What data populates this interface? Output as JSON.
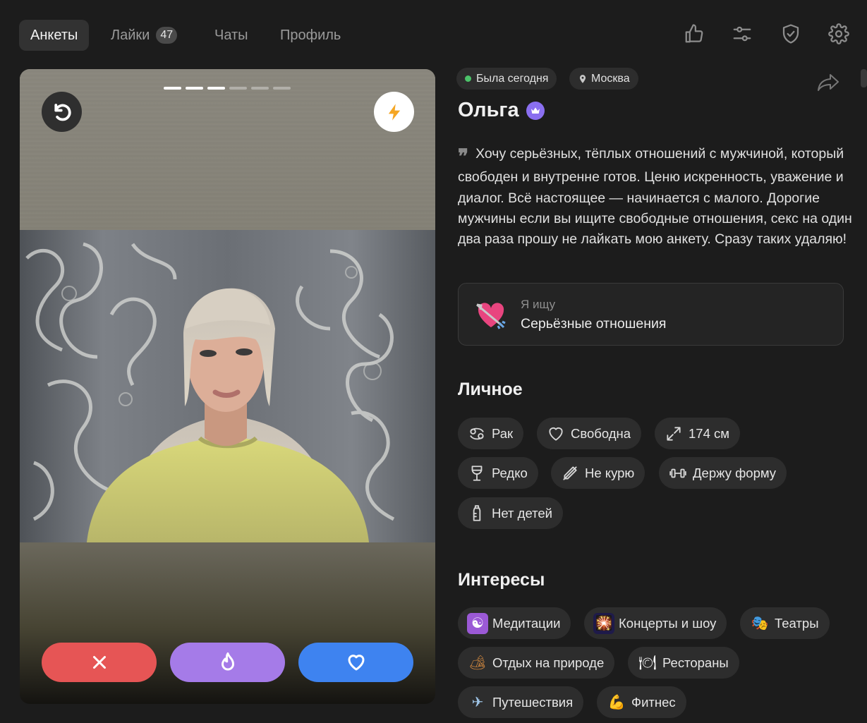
{
  "nav": {
    "tabs": [
      {
        "label": "Анкеты",
        "active": true
      },
      {
        "label": "Лайки",
        "count": "47"
      },
      {
        "label": "Чаты"
      },
      {
        "label": "Профиль"
      }
    ],
    "icons": [
      "thumbs-up-icon",
      "sliders-icon",
      "shield-check-icon",
      "gear-icon"
    ]
  },
  "card": {
    "photo_count": 6,
    "current_photo": 3,
    "buttons": {
      "undo": "undo-icon",
      "boost": "lightning-icon",
      "dislike": "close-icon",
      "superlike": "flame-icon",
      "like": "heart-icon"
    },
    "colors": {
      "dislike": "#e65555",
      "superlike": "#a57be8",
      "like": "#3e83f0"
    }
  },
  "profile": {
    "status": "Была сегодня",
    "city": "Москва",
    "name": "Ольга",
    "quote_mark": "❞",
    "about": "Хочу серьёзных, тёплых отношений с мужчиной, который свободен и внутренне готов. Ценю искренность, уважение и диалог. Всё настоящее — начинается с малого. Дорогие мужчины если вы ищите свободные отношения, секс на один два раза прошу не лайкать мою анкету. Сразу таких удаляю!",
    "seeking_label": "Я ищу",
    "seeking_value": "Серьёзные отношения"
  },
  "personal": {
    "title": "Личное",
    "items": [
      {
        "label": "Рак",
        "icon": "cancer-zodiac-icon"
      },
      {
        "label": "Свободна",
        "icon": "heart-outline-icon"
      },
      {
        "label": "174 см",
        "icon": "height-arrows-icon"
      },
      {
        "label": "Редко",
        "icon": "wine-glass-icon"
      },
      {
        "label": "Не курю",
        "icon": "no-smoking-icon"
      },
      {
        "label": "Держу форму",
        "icon": "dumbbell-icon"
      },
      {
        "label": "Нет детей",
        "icon": "baby-bottle-icon"
      }
    ]
  },
  "interests": {
    "title": "Интересы",
    "items": [
      {
        "label": "Медитации",
        "emoji": "☯"
      },
      {
        "label": "Концерты и шоу",
        "emoji": "🎇"
      },
      {
        "label": "Театры",
        "emoji": "🎭"
      },
      {
        "label": "Отдых на природе",
        "emoji": "🏕"
      },
      {
        "label": "Рестораны",
        "emoji": "🍽"
      },
      {
        "label": "Путешествия",
        "emoji": "✈"
      },
      {
        "label": "Фитнес",
        "emoji": "💪"
      }
    ]
  }
}
